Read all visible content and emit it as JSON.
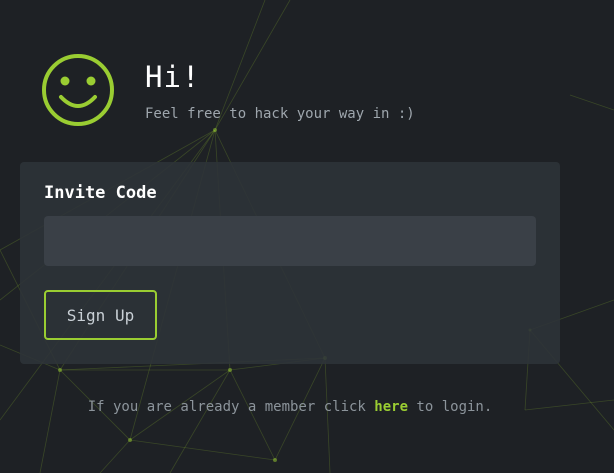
{
  "header": {
    "icon": "smiley-icon",
    "title": "Hi!",
    "subtitle": "Feel free to hack your way in :)"
  },
  "form": {
    "invite_label": "Invite Code",
    "invite_value": "",
    "invite_placeholder": "",
    "signup_label": "Sign Up"
  },
  "footer": {
    "prefix": "If you are already a member click ",
    "link": "here",
    "suffix": " to login."
  },
  "colors": {
    "accent": "#9acd32",
    "background": "#1e2125",
    "card": "#2e3339",
    "input": "#3a4047"
  }
}
